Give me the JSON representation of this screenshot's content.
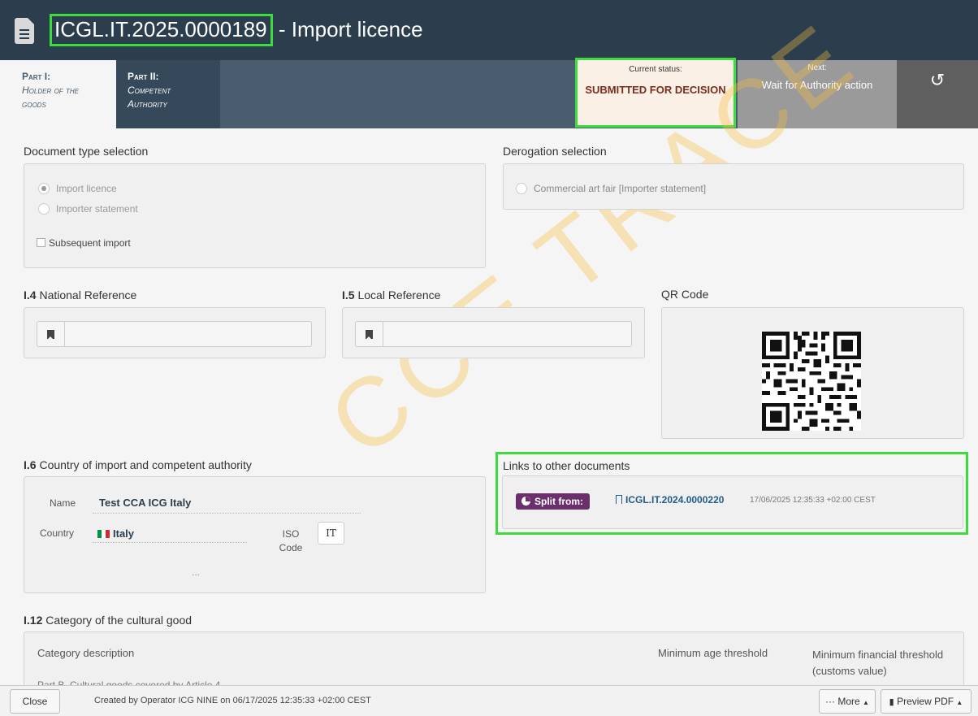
{
  "header": {
    "reference": "ICGL.IT.2025.0000189",
    "title_suffix": " - Import licence"
  },
  "tabs": [
    {
      "part": "Part I:",
      "name": "Holder of the goods"
    },
    {
      "part": "Part II:",
      "name": "Competent Authority"
    }
  ],
  "status": {
    "current_label": "Current status:",
    "current_value": "SUBMITTED FOR DECISION",
    "next_label": "Next:",
    "next_value": "Wait for Authority action"
  },
  "document_type": {
    "heading": "Document type selection",
    "options": [
      {
        "label": "Import licence",
        "selected": true
      },
      {
        "label": "Importer statement",
        "selected": false
      }
    ],
    "subsequent_import_label": "Subsequent import"
  },
  "derogation": {
    "heading": "Derogation selection",
    "option_main": "Commercial art fair",
    "option_suffix": " [Importer statement]"
  },
  "national_ref": {
    "num": "I.4",
    "label": " National Reference",
    "value": ""
  },
  "local_ref": {
    "num": "I.5",
    "label": " Local Reference",
    "value": ""
  },
  "qr": {
    "label": "QR Code"
  },
  "country_section": {
    "num": "I.6",
    "label": " Country of import and competent authority",
    "name_label": "Name",
    "name_value": "Test CCA ICG Italy",
    "country_label": "Country",
    "country_value": "Italy",
    "iso_label": "ISO Code",
    "iso_value": "IT",
    "more": "..."
  },
  "links": {
    "heading": "Links to other documents",
    "badge": "Split from:",
    "ref": "ICGL.IT.2024.0000220",
    "date": "17/06/2025 12:35:33 +02:00 CEST"
  },
  "category": {
    "num": "I.12",
    "label": " Category of the cultural good",
    "col_description": "Category description",
    "col_age": "Minimum age threshold",
    "col_financial": "Minimum financial threshold (customs value)",
    "row_partial": "Part B. Cultural goods covered by Article 4"
  },
  "watermark": "CCE TRACE",
  "footer": {
    "close": "Close",
    "created": "Created by Operator ICG NINE on 06/17/2025 12:35:33 +02:00 CEST",
    "more": "··· More",
    "preview": "Preview PDF"
  }
}
